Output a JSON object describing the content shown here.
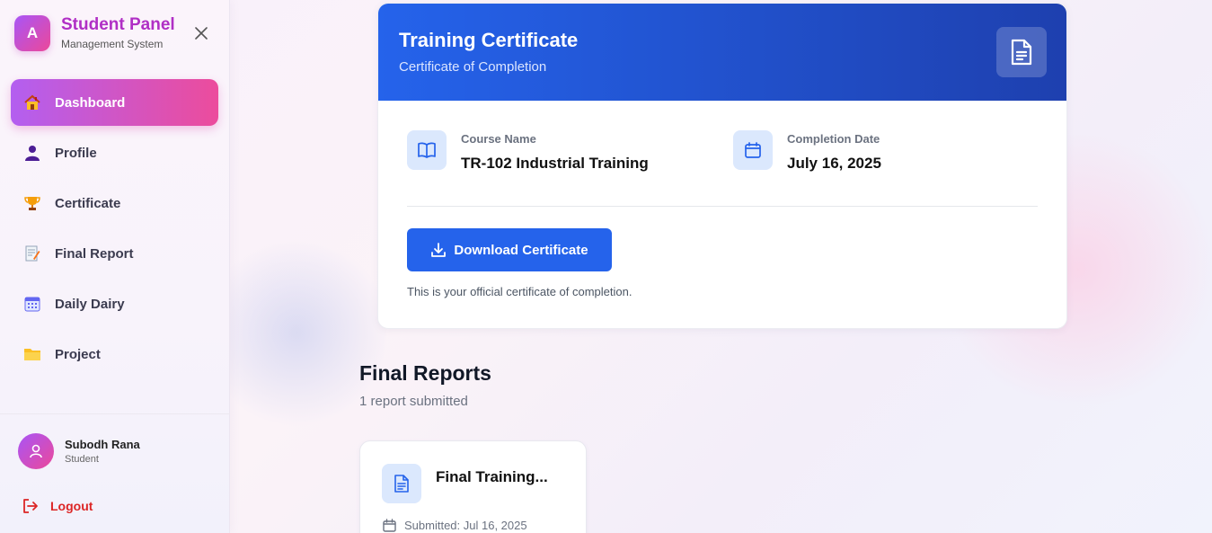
{
  "sidebar": {
    "logo_letter": "A",
    "title": "Student Panel",
    "subtitle": "Management System",
    "nav": [
      {
        "label": "Dashboard",
        "icon": "house-emoji-icon",
        "active": true
      },
      {
        "label": "Profile",
        "icon": "person-icon"
      },
      {
        "label": "Certificate",
        "icon": "trophy-icon"
      },
      {
        "label": "Final Report",
        "icon": "memo-icon"
      },
      {
        "label": "Daily Dairy",
        "icon": "calendar-grid-icon"
      },
      {
        "label": "Project",
        "icon": "folder-icon"
      }
    ],
    "user": {
      "name": "Subodh Rana",
      "role": "Student"
    },
    "logout_label": "Logout"
  },
  "certificate": {
    "title": "Training Certificate",
    "subtitle": "Certificate of Completion",
    "course_label": "Course Name",
    "course_value": "TR-102 Industrial Training",
    "date_label": "Completion Date",
    "date_value": "July 16, 2025",
    "download_label": "Download Certificate",
    "note": "This is your official certificate of completion."
  },
  "reports": {
    "title": "Final Reports",
    "count_text": "1 report submitted",
    "items": [
      {
        "name": "Final Training...",
        "submitted": "Submitted: Jul 16, 2025"
      }
    ]
  },
  "colors": {
    "accent_gradient_start": "#a855f7",
    "accent_gradient_end": "#ec4899",
    "primary_blue": "#2563eb",
    "logout_red": "#dc2626"
  }
}
